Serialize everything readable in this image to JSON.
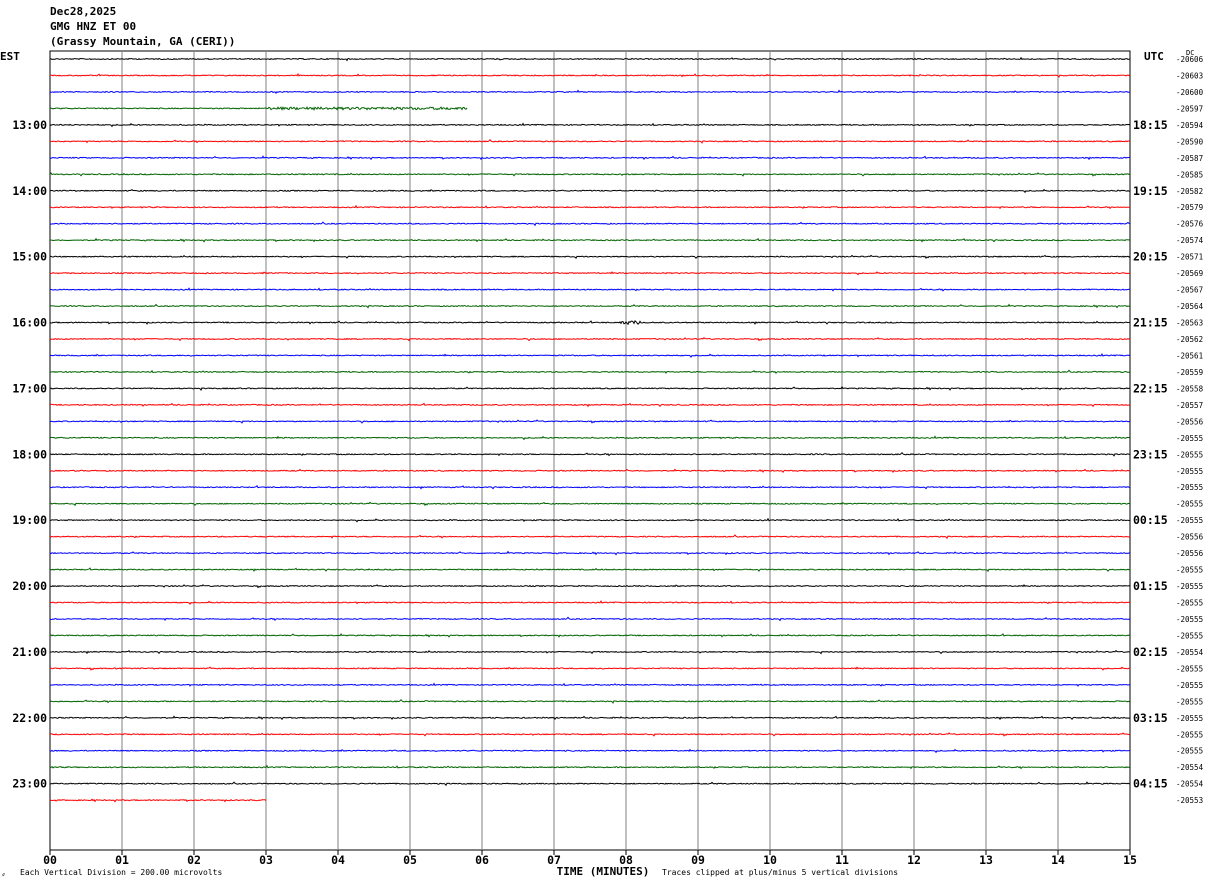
{
  "header": {
    "date": "Dec28,2025",
    "channel": "GMG HNZ ET 00",
    "station": "(Grassy Mountain, GA (CERI))"
  },
  "axis": {
    "left_tz": "EST",
    "right_tz": "UTC",
    "dc_label": "DC",
    "xlabel": "TIME (MINUTES)",
    "x_ticks": [
      "00",
      "01",
      "02",
      "03",
      "04",
      "05",
      "06",
      "07",
      "08",
      "09",
      "10",
      "11",
      "12",
      "13",
      "14",
      "15"
    ]
  },
  "footer": {
    "scale": "Each Vertical Division =  200.00 microvolts",
    "clip_note": "Traces clipped at plus/minus 5 vertical divisions",
    "logo_glyph": "⸗"
  },
  "colors": {
    "trace": [
      "#000000",
      "#ff0000",
      "#0000ff",
      "#006400"
    ],
    "grid": "#808080"
  },
  "chart_data": {
    "type": "helicorder",
    "x_range_minutes": [
      0,
      15
    ],
    "rows_per_hour": 4,
    "left_hour_labels": [
      "13:00",
      "14:00",
      "15:00",
      "16:00",
      "17:00",
      "18:00",
      "19:00",
      "20:00",
      "21:00",
      "22:00",
      "23:00"
    ],
    "right_hour_labels": [
      "18:15",
      "19:15",
      "20:15",
      "21:15",
      "22:15",
      "23:15",
      "00:15",
      "01:15",
      "02:15",
      "03:15",
      "04:15"
    ],
    "dc_offsets": [
      "-20606",
      "-20603",
      "-20600",
      "-20597",
      "-20594",
      "-20590",
      "-20587",
      "-20585",
      "-20582",
      "-20579",
      "-20576",
      "-20574",
      "-20571",
      "-20569",
      "-20567",
      "-20564",
      "-20563",
      "-20562",
      "-20561",
      "-20559",
      "-20558",
      "-20557",
      "-20556",
      "-20555",
      "-20555",
      "-20555",
      "-20555",
      "-20555",
      "-20555",
      "-20556",
      "-20556",
      "-20555",
      "-20555",
      "-20555",
      "-20555",
      "-20555",
      "-20554",
      "-20555",
      "-20555",
      "-20555",
      "-20555",
      "-20555",
      "-20555",
      "-20554",
      "-20554",
      "-20553"
    ],
    "row_end_minutes": [
      15,
      15,
      15,
      5.8,
      15,
      15,
      15,
      15,
      15,
      15,
      15,
      15,
      15,
      15,
      15,
      15,
      15,
      15,
      15,
      15,
      15,
      15,
      15,
      15,
      15,
      15,
      15,
      15,
      15,
      15,
      15,
      15,
      15,
      15,
      15,
      15,
      15,
      15,
      15,
      15,
      15,
      15,
      15,
      15,
      15,
      3
    ],
    "events": [
      {
        "row": 3,
        "start_min": 3.0,
        "end_min": 5.8,
        "amplitude": "elevated"
      },
      {
        "row": 16,
        "start_min": 7.9,
        "end_min": 8.2,
        "amplitude": "burst"
      }
    ]
  }
}
